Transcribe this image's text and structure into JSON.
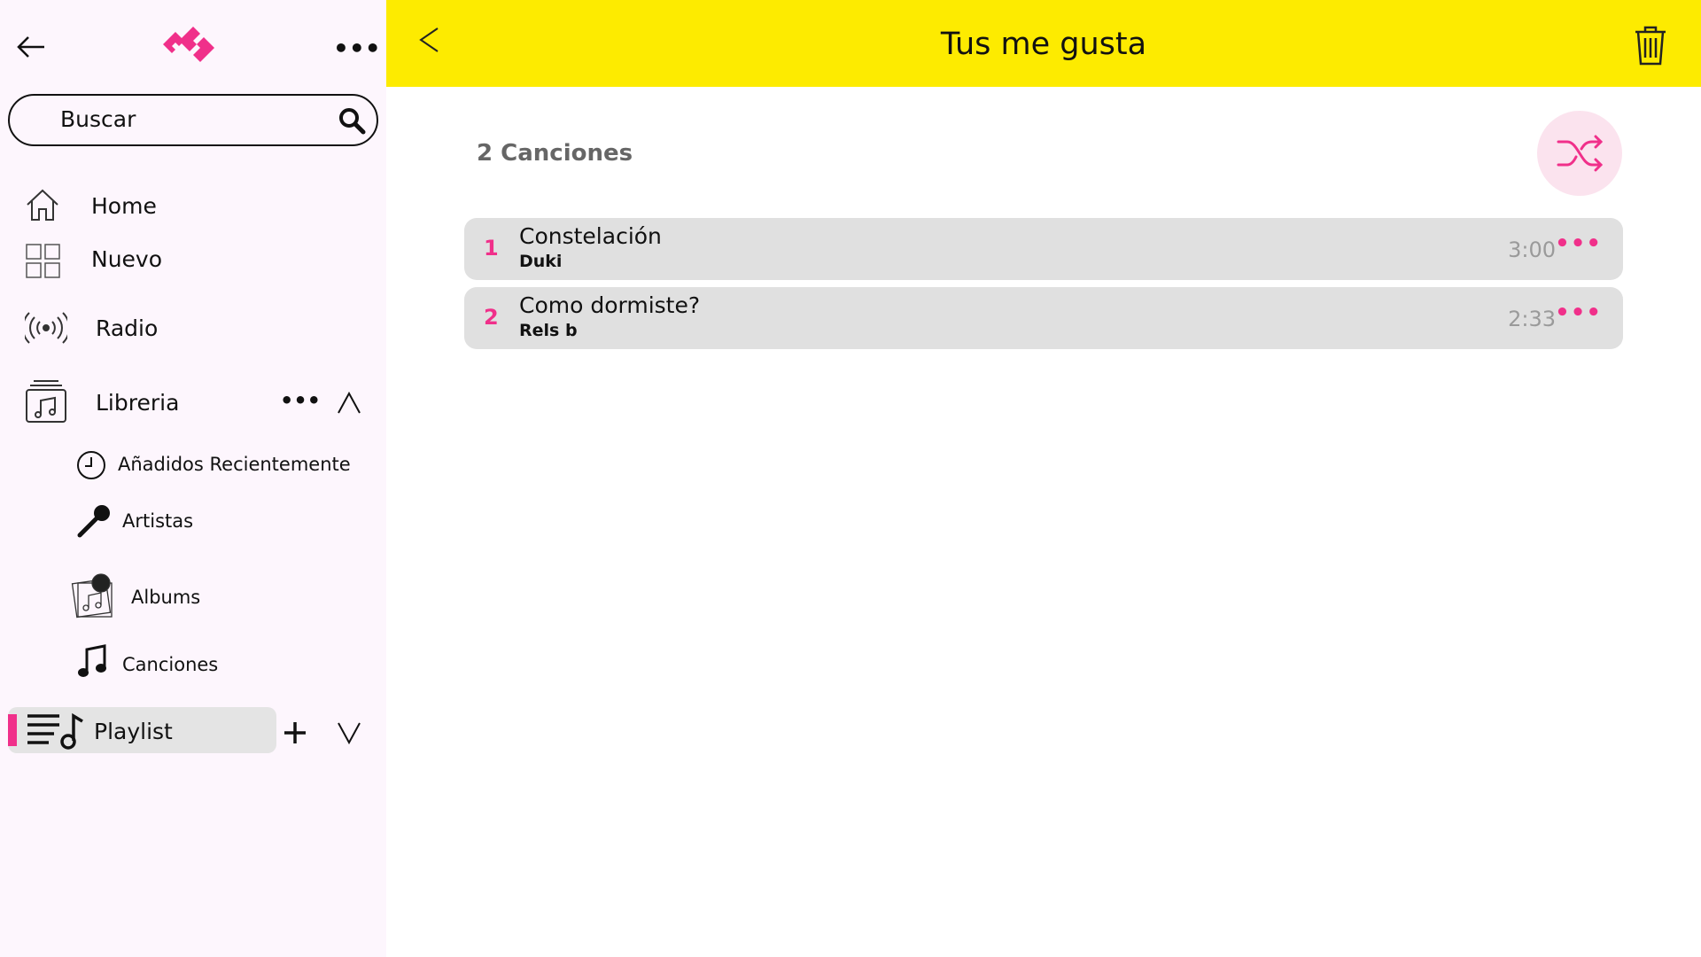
{
  "sidebar": {
    "search_placeholder": "Buscar",
    "items": [
      {
        "label": "Home"
      },
      {
        "label": "Nuevo"
      },
      {
        "label": "Radio"
      },
      {
        "label": "Libreria"
      }
    ],
    "library_items": [
      {
        "label": "Añadidos Recientemente"
      },
      {
        "label": "Artistas"
      },
      {
        "label": "Albums"
      },
      {
        "label": "Canciones"
      }
    ],
    "playlist_label": "Playlist",
    "accent": "#f0308a"
  },
  "header": {
    "title": "Tus me gusta",
    "background": "#fdeb00"
  },
  "main": {
    "count_label": "2 Canciones",
    "songs": [
      {
        "index": "1",
        "title": "Constelación",
        "artist": "Duki",
        "duration": "3:00"
      },
      {
        "index": "2",
        "title": "Como dormiste?",
        "artist": "Rels b",
        "duration": "2:33"
      }
    ]
  }
}
